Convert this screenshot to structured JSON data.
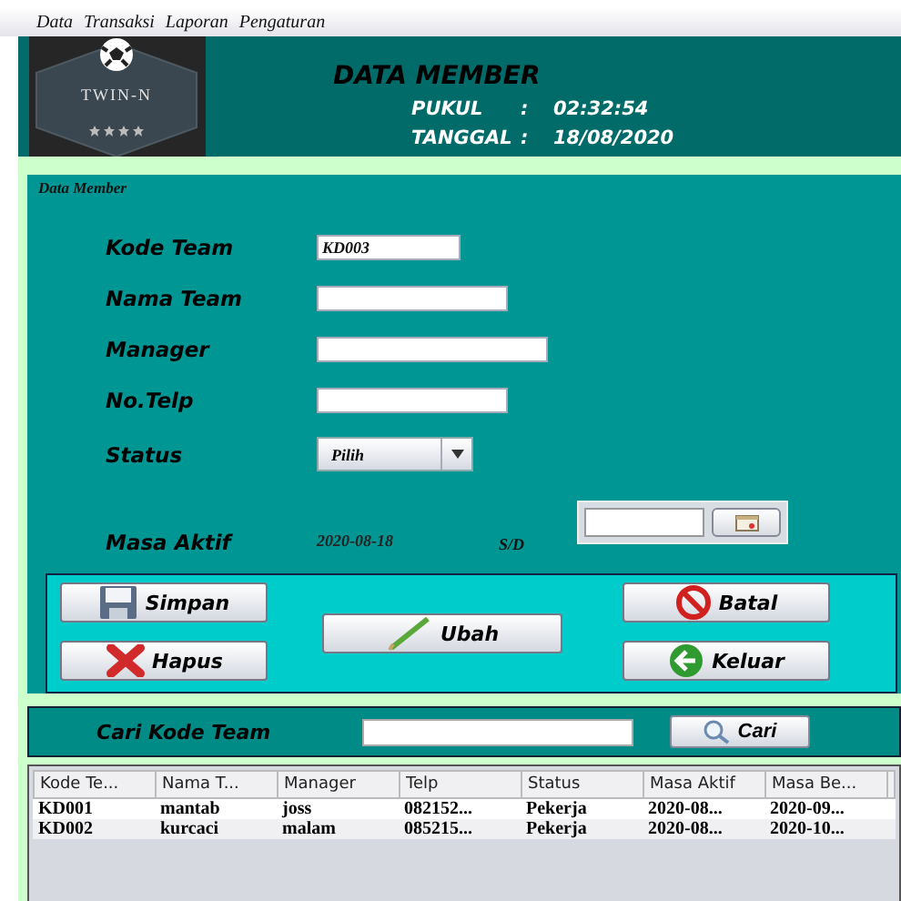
{
  "menu": [
    "Data",
    "Transaksi",
    "Laporan",
    "Pengaturan"
  ],
  "header": {
    "logo_text": "TWIN-N",
    "title": "DATA MEMBER",
    "time_label": "PUKUL",
    "time_sep": ":",
    "time": "02:32:54",
    "date_label": "TANGGAL",
    "date_sep": ":",
    "date": "18/08/2020"
  },
  "form": {
    "title": "Data Member",
    "fields": [
      {
        "label": "Kode Team",
        "kind": "text",
        "value": "KD003"
      },
      {
        "label": "Nama Team",
        "kind": "text"
      },
      {
        "label": "Manager",
        "kind": "text"
      },
      {
        "label": "No.Telp",
        "kind": "text"
      },
      {
        "label": "Status",
        "kind": "select",
        "value": "Pilih"
      },
      {
        "label": "Masa Aktif",
        "kind": "range",
        "value": "2020-08-18",
        "separator": "S/D"
      }
    ]
  },
  "buttons": [
    "Simpan",
    "Hapus",
    "Ubah",
    "Batal",
    "Keluar"
  ],
  "search": {
    "label": "Cari Kode Team",
    "button": "Cari"
  },
  "table": {
    "columns": [
      "Kode Te...",
      "Nama T...",
      "Manager",
      "Telp",
      "Status",
      "Masa Aktif",
      "Masa Be..."
    ],
    "rows": [
      [
        "KD001",
        "mantab",
        "joss",
        "082152...",
        "Pekerja",
        "2020-08...",
        "2020-09..."
      ],
      [
        "KD002",
        "kurcaci",
        "malam",
        "085215...",
        "Pekerja",
        "2020-08...",
        "2020-10..."
      ]
    ]
  }
}
